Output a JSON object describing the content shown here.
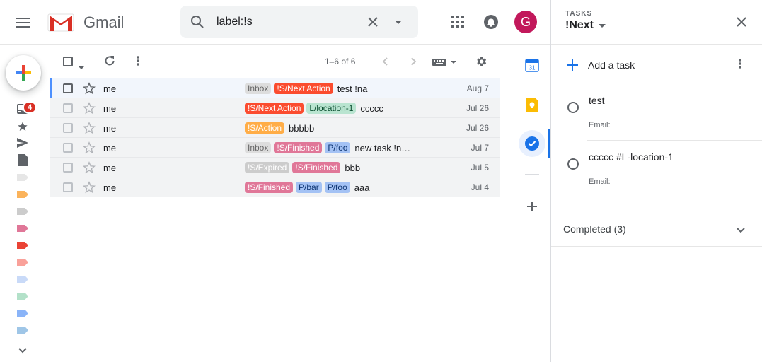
{
  "header": {
    "brand": "Gmail",
    "search_value": "label:!s"
  },
  "avatar_letter": "G",
  "left_rail": {
    "inbox_badge": "4",
    "label_colors": [
      "#e6e6e6",
      "#fbb35b",
      "#cccccc",
      "#e07798",
      "#ea4335",
      "#f9a19a",
      "#c9daf8",
      "#b3e1c9",
      "#8ab4f8",
      "#9fc6e7"
    ]
  },
  "toolbar": {
    "page_info": "1–6 of 6"
  },
  "emails": [
    {
      "sender": "me",
      "labels": [
        {
          "text": "Inbox",
          "bg": "#dddddd",
          "fg": "#666666"
        },
        {
          "text": "!S/Next Action",
          "bg": "#fb4c2f",
          "fg": "#ffffff"
        }
      ],
      "subject": "test !na",
      "date": "Aug 7"
    },
    {
      "sender": "me",
      "labels": [
        {
          "text": "!S/Next Action",
          "bg": "#fb4c2f",
          "fg": "#ffffff"
        },
        {
          "text": "L/location-1",
          "bg": "#b9e4d0",
          "fg": "#0b4f30"
        }
      ],
      "subject": "ccccc",
      "date": "Jul 26"
    },
    {
      "sender": "me",
      "labels": [
        {
          "text": "!S/Action",
          "bg": "#ffad47",
          "fg": "#ffffff"
        }
      ],
      "subject": "bbbbb",
      "date": "Jul 26"
    },
    {
      "sender": "me",
      "labels": [
        {
          "text": "Inbox",
          "bg": "#dddddd",
          "fg": "#666666"
        },
        {
          "text": "!S/Finished",
          "bg": "#e07798",
          "fg": "#ffffff"
        },
        {
          "text": "P/foo",
          "bg": "#a4c2f4",
          "fg": "#0d3472"
        }
      ],
      "subject": "new task !n…",
      "date": "Jul 7"
    },
    {
      "sender": "me",
      "labels": [
        {
          "text": "!S/Expired",
          "bg": "#cccccc",
          "fg": "#ffffff"
        },
        {
          "text": "!S/Finished",
          "bg": "#e07798",
          "fg": "#ffffff"
        }
      ],
      "subject": "bbb",
      "date": "Jul 5"
    },
    {
      "sender": "me",
      "labels": [
        {
          "text": "!S/Finished",
          "bg": "#e07798",
          "fg": "#ffffff"
        },
        {
          "text": "P/bar",
          "bg": "#a4c2f4",
          "fg": "#0d3472"
        },
        {
          "text": "P/foo",
          "bg": "#a4c2f4",
          "fg": "#0d3472"
        }
      ],
      "subject": "aaa",
      "date": "Jul 4"
    }
  ],
  "tasks": {
    "header_small": "TASKS",
    "list_name": "!Next",
    "add_task": "Add a task",
    "items": [
      {
        "title": "test",
        "sub": "Email:"
      },
      {
        "title": "ccccc #L-location-1",
        "sub": "Email:"
      }
    ],
    "completed": "Completed (3)"
  }
}
